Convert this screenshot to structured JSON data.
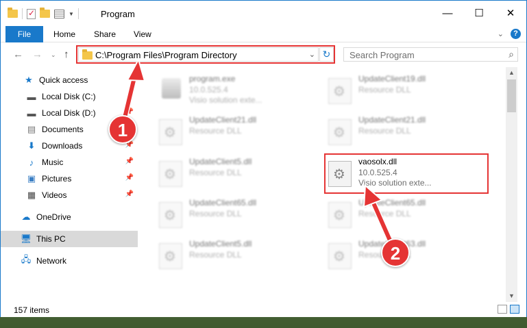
{
  "window": {
    "title": "Program"
  },
  "ribbon": {
    "tabs": [
      "File",
      "Home",
      "Share",
      "View"
    ],
    "help": "?"
  },
  "address": {
    "path": "C:\\Program Files\\Program Directory"
  },
  "search": {
    "placeholder": "Search Program"
  },
  "sidebar": {
    "items": [
      {
        "label": "Quick access",
        "icon": "star-icon",
        "color": "#1979ca"
      },
      {
        "label": "Local Disk (C:)",
        "icon": "drive-icon",
        "pinned": true
      },
      {
        "label": "Local Disk (D:)",
        "icon": "drive-icon",
        "pinned": true
      },
      {
        "label": "Documents",
        "icon": "documents-icon",
        "pinned": true
      },
      {
        "label": "Downloads",
        "icon": "downloads-icon",
        "pinned": true
      },
      {
        "label": "Music",
        "icon": "music-icon",
        "pinned": true
      },
      {
        "label": "Pictures",
        "icon": "pictures-icon",
        "pinned": true
      },
      {
        "label": "Videos",
        "icon": "videos-icon",
        "pinned": true
      },
      {
        "label": "OneDrive",
        "icon": "cloud-icon"
      },
      {
        "label": "This PC",
        "icon": "pc-icon",
        "selected": true
      },
      {
        "label": "Network",
        "icon": "network-icon"
      }
    ]
  },
  "files": [
    {
      "name": "program.exe",
      "line2": "10.0.525.4",
      "line3": "Visio solution exte..."
    },
    {
      "name": "UpdateClient19.dll",
      "line2": "Resource DLL"
    },
    {
      "name": "UpdateClient21.dll",
      "line2": "Resource DLL"
    },
    {
      "name": "UpdateClient21.dll",
      "line2": "Resource DLL"
    },
    {
      "name": "UpdateClient5.dll",
      "line2": "Resource DLL"
    },
    {
      "name": "vaosolx.dll",
      "line2": "10.0.525.4",
      "line3": "Visio solution exte...",
      "highlighted": true
    },
    {
      "name": "UpdateClient65.dll",
      "line2": "Resource DLL"
    },
    {
      "name": "UpdateClient65.dll",
      "line2": "Resource DLL"
    },
    {
      "name": "UpdateClient5.dll",
      "line2": "Resource DLL"
    },
    {
      "name": "UpdateClient63.dll",
      "line2": "Resource DLL"
    }
  ],
  "status": {
    "items_count": "157 items"
  },
  "annotations": {
    "step1": "1",
    "step2": "2",
    "color": "#e53434"
  }
}
